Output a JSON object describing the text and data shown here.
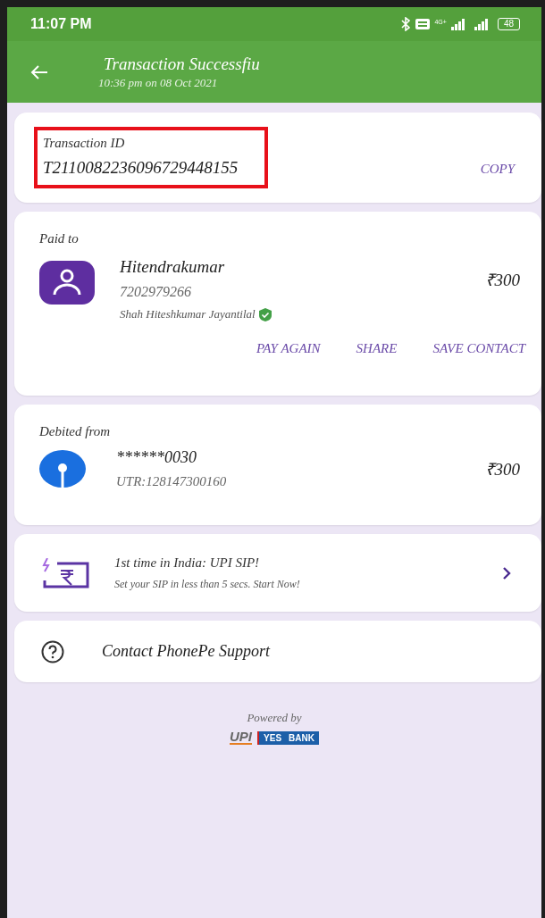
{
  "status_bar": {
    "time": "11:07 PM",
    "network": "4G+",
    "battery": "48"
  },
  "header": {
    "title": "Transaction Successfiu",
    "subtitle": "10:36 pm on 08 Oct 2021"
  },
  "transaction": {
    "label": "Transaction ID",
    "id": "T2110082236096729448155",
    "highlighted": true,
    "action": "COPY"
  },
  "paid_to": {
    "label": "Paid to",
    "name": "Hitendrakumar",
    "phone": "7202979266",
    "registered_name": "Shah Hiteshkumar Jayantilal",
    "verified": true,
    "amount": "₹300",
    "actions": [
      "PAY AGAIN",
      "SHARE",
      "SAVE CONTACT"
    ]
  },
  "debited_from": {
    "label": "Debited from",
    "account": "******0030",
    "utr": "UTR:128147300160",
    "amount": "₹300"
  },
  "promo": {
    "title": "1st time in India: UPI SIP!",
    "subtitle": "Set your SIP in less than 5 secs. Start Now!"
  },
  "support": {
    "label": "Contact PhonePe Support"
  },
  "footer": {
    "caption": "Powered by",
    "logos": [
      "UPI",
      "YES",
      "BANK"
    ]
  }
}
